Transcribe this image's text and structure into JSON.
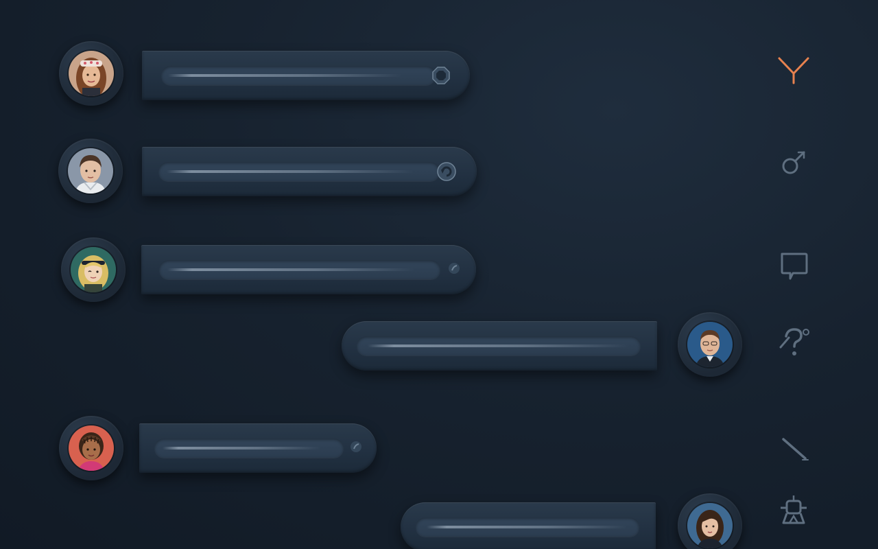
{
  "app": {
    "background": "#17222f",
    "accent": "#e7824f"
  },
  "messages": [
    {
      "id": "m1",
      "side": "left",
      "avatar": "avatar-woman-brown-hair-headband",
      "trailing_icon": "octagon-icon"
    },
    {
      "id": "m2",
      "side": "left",
      "avatar": "avatar-man-short-hair-hoodie",
      "trailing_icon": "refresh-icon"
    },
    {
      "id": "m3",
      "side": "left",
      "avatar": "avatar-woman-blonde-headband",
      "trailing_icon": "dot-icon"
    },
    {
      "id": "m4",
      "side": "right",
      "avatar": "avatar-man-blue-ring",
      "trailing_icon": ""
    },
    {
      "id": "m5",
      "side": "left",
      "avatar": "avatar-woman-braids-pink",
      "trailing_icon": "dot-icon"
    },
    {
      "id": "m6",
      "side": "right",
      "avatar": "avatar-woman-dark-hair",
      "trailing_icon": ""
    }
  ],
  "rail": [
    {
      "icon": "y-branch-icon",
      "active": true,
      "color": "#e7824f"
    },
    {
      "icon": "bomb-icon",
      "active": false,
      "color": "#5f6f80"
    },
    {
      "icon": "chat-bubble-icon",
      "active": false,
      "color": "#5f6f80"
    },
    {
      "icon": "help-icon",
      "active": false,
      "color": "#5f6f80"
    },
    {
      "icon": "pen-line-icon",
      "active": false,
      "color": "#5f6f80"
    },
    {
      "icon": "robot-icon",
      "active": false,
      "color": "#5f6f80"
    }
  ]
}
